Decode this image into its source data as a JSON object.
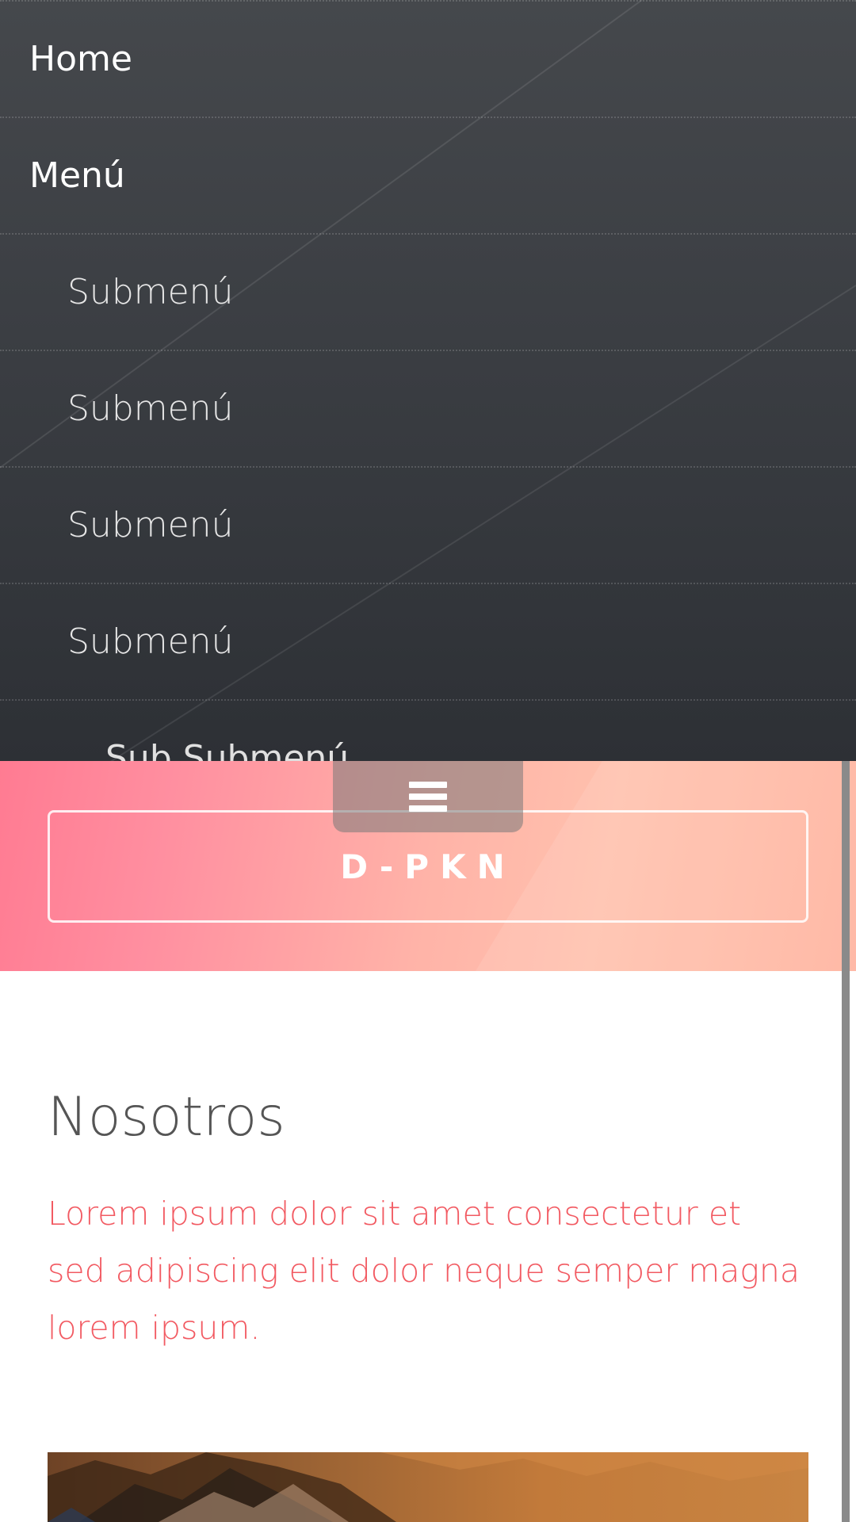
{
  "nav": {
    "items": [
      {
        "label": "Home",
        "level": 0
      },
      {
        "label": "Menú",
        "level": 0
      },
      {
        "label": "Submenú",
        "level": 1
      },
      {
        "label": "Submenú",
        "level": 1
      },
      {
        "label": "Submenú",
        "level": 1
      },
      {
        "label": "Submenú",
        "level": 1
      },
      {
        "label": "Sub Submenú",
        "level": 2
      }
    ]
  },
  "header": {
    "menu_icon": "hamburger-icon",
    "brand": "D-PKN"
  },
  "content": {
    "title": "Nosotros",
    "text": "Lorem ipsum dolor sit amet consectetur et sed adipiscing elit dolor neque semper magna lorem ipsum."
  },
  "colors": {
    "nav_bg": "#3c3f44",
    "header_pink": "#ff7b92",
    "header_peach": "#ffc1ad",
    "accent_text": "#f25a62",
    "title_text": "#555555"
  }
}
